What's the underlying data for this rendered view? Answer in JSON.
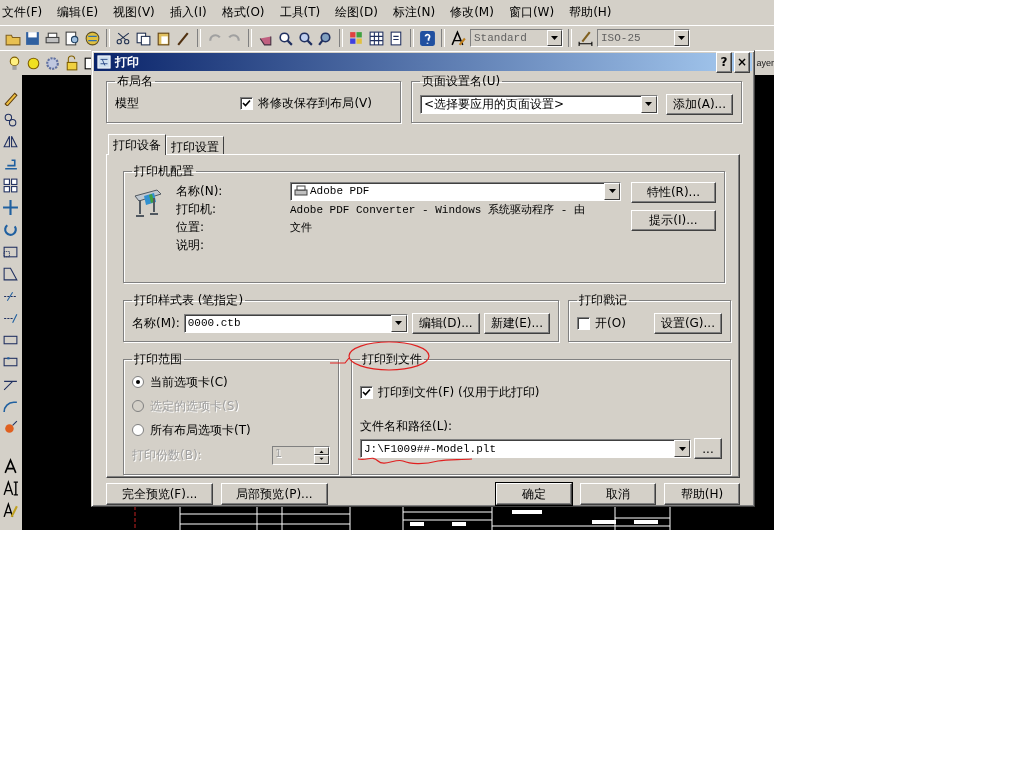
{
  "menu_bar": {
    "items": [
      "文件(F)",
      "编辑(E)",
      "视图(V)",
      "插入(I)",
      "格式(O)",
      "工具(T)",
      "绘图(D)",
      "标注(N)",
      "修改(M)",
      "窗口(W)",
      "帮助(H)"
    ]
  },
  "toolbar": {
    "text_style": "Standard",
    "dim_style": "ISO-25"
  },
  "layer_toolbar": {
    "label": "ayer"
  },
  "dialog": {
    "title": "打印",
    "help_button": "?",
    "close_button": "×",
    "layout_name": {
      "title": "布局名",
      "value": "模型",
      "save_checkbox": {
        "label": "将修改保存到布局(V)",
        "checked": true
      }
    },
    "page_setup": {
      "title": "页面设置名(U)",
      "value": "<选择要应用的页面设置>",
      "add_button": "添加(A)..."
    },
    "tabs": [
      {
        "label": "打印设备",
        "selected": true
      },
      {
        "label": "打印设置",
        "selected": false
      }
    ],
    "printer_config": {
      "title": "打印机配置",
      "name_label": "名称(N):",
      "name_value": "Adobe PDF",
      "printer_label": "打印机:",
      "printer_value": "Adobe PDF Converter - Windows 系统驱动程序 - 由",
      "location_label": "位置:",
      "location_value": "文件",
      "description_label": "说明:",
      "properties_button": "特性(R)...",
      "hints_button": "提示(I)..."
    },
    "plot_style_table": {
      "title": "打印样式表 (笔指定)",
      "name_label": "名称(M):",
      "name_value": "0000.ctb",
      "edit_button": "编辑(D)...",
      "new_button": "新建(E)..."
    },
    "plot_stamp": {
      "title": "打印戳记",
      "checkbox": {
        "label": "开(O)",
        "checked": false
      },
      "settings_button": "设置(G)..."
    },
    "plot_range": {
      "title": "打印范围",
      "options": [
        {
          "label": "当前选项卡(C)",
          "selected": true,
          "disabled": false
        },
        {
          "label": "选定的选项卡(S)",
          "selected": false,
          "disabled": true
        },
        {
          "label": "所有布局选项卡(T)",
          "selected": false,
          "disabled": false
        }
      ],
      "copies_label": "打印份数(B):",
      "copies_value": "1",
      "copies_disabled": true
    },
    "plot_to_file": {
      "title": "打印到文件",
      "checkbox": {
        "label": "打印到文件(F) (仅用于此打印)",
        "checked": true
      },
      "path_label": "文件名和路径(L):",
      "path_value": "J:\\F1009##-Model.plt",
      "browse_button": "..."
    },
    "buttons": [
      {
        "label": "完全预览(F)...",
        "default": false
      },
      {
        "label": "局部预览(P)...",
        "default": false
      },
      {
        "label": "确定",
        "default": true
      },
      {
        "label": "取消",
        "default": false
      },
      {
        "label": "帮助(H)",
        "default": false
      }
    ]
  }
}
